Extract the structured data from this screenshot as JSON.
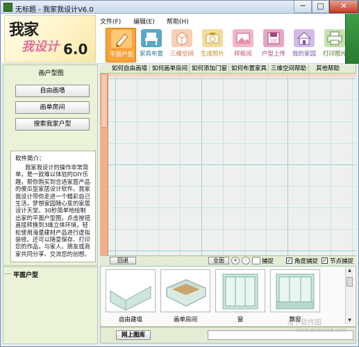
{
  "window": {
    "title": "无标题 - 我家我设计V6.0",
    "min_symbol": "─",
    "max_symbol": "□",
    "close_symbol": "✕"
  },
  "logo": {
    "line1": "我家",
    "line2": "我设计",
    "version": "6.0"
  },
  "menu": {
    "items": [
      "文件(F)",
      "编辑(E)",
      "帮助(H)"
    ]
  },
  "toolbar": {
    "items": [
      {
        "label": "平面户型",
        "icon": "pencil-icon",
        "color": "#f7a43c"
      },
      {
        "label": "家具布置",
        "icon": "chair-icon",
        "color": "#5aa8c8"
      },
      {
        "label": "三维空间",
        "icon": "box-icon",
        "color": "#f4b08a"
      },
      {
        "label": "生成照片",
        "icon": "camera-icon",
        "color": "#e8c060"
      },
      {
        "label": "样板间",
        "icon": "image-icon",
        "color": "#e78aa6"
      },
      {
        "label": "户型上传",
        "icon": "disk-icon",
        "color": "#c05a8a"
      },
      {
        "label": "我的家园",
        "icon": "house-icon",
        "color": "#a482c8"
      },
      {
        "label": "打印图片",
        "icon": "printer-icon",
        "color": "#8ab86a"
      }
    ]
  },
  "left": {
    "title": "画户型图",
    "buttons": [
      "自由画墙",
      "画单房间",
      "搜索我家户型"
    ],
    "intro_heading": "软件简介：",
    "intro_body": "我家我设计的操作非常简单，是一款难以体验的DIY乐趣，帮你购买到合适家居产品的傻瓜型家居设计软件。我家我设计带你走进一个精彩自己生活，梦想家园随心变的家居设计天堂。30秒简单地绘制出家的平面户型图，点击按钮直接转换到3维立体环境，轻松使用海量建材产品进行虚拟装修。还可以随意保存、打印您的作品，与家人、朋友或商家共同分享、交流您的创想。",
    "tree_label": "平面户型"
  },
  "tabs": [
    "如何自由画墙",
    "如何画单房间",
    "如何添加门窗",
    "如何布置家具",
    "三维空间帮助",
    "其他帮助"
  ],
  "workspace_bar": {
    "back": "回退",
    "full": "全图",
    "snap1": "捕捉",
    "snap2": "角度捕捉",
    "snap3": "节点捕捉",
    "zoom_in": "+",
    "zoom_out": "-"
  },
  "library": {
    "items": [
      "自由建墙",
      "画单房间",
      "窗",
      "飘窗"
    ]
  },
  "bottom": {
    "online_lib": "网上图库"
  },
  "watermark": {
    "text": "当下软件园",
    "url": "www.downxia.com"
  }
}
